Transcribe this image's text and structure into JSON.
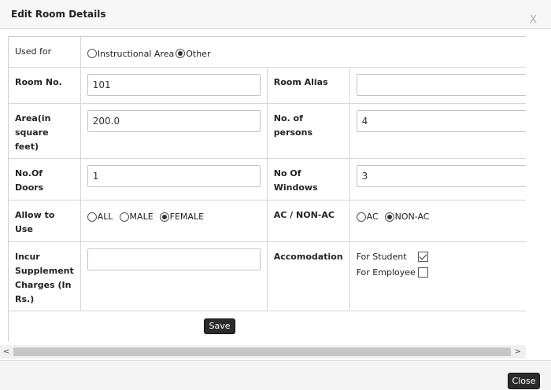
{
  "dialog": {
    "title": "Edit Room Details",
    "close_glyph": "X"
  },
  "used_for": {
    "label": "Used for",
    "options": [
      "Instructional Area",
      "Other"
    ],
    "selected": "Other"
  },
  "room_no": {
    "label": "Room No.",
    "value": "101"
  },
  "room_alias": {
    "label": "Room Alias",
    "value": ""
  },
  "area": {
    "label": "Area(in square feet)",
    "value": "200.0"
  },
  "persons": {
    "label": "No. of persons",
    "value": "4"
  },
  "doors": {
    "label": "No.Of Doors",
    "value": "1"
  },
  "windows": {
    "label": "No Of Windows",
    "value": "3"
  },
  "allow_to_use": {
    "label": "Allow to Use",
    "options": [
      "ALL",
      "MALE",
      "FEMALE"
    ],
    "selected": "FEMALE"
  },
  "ac": {
    "label": "AC / NON-AC",
    "options": [
      "AC",
      "NON-AC"
    ],
    "selected": "NON-AC"
  },
  "supplement": {
    "label": "Incur Supplement Charges (In Rs.)",
    "value": ""
  },
  "accomodation": {
    "label": "Accomodation",
    "items": [
      {
        "label": "For Student",
        "checked": true
      },
      {
        "label": "For Employee",
        "checked": false
      }
    ]
  },
  "buttons": {
    "save": "Save",
    "close": "Close"
  },
  "scrollbar": {
    "left_arrow": "<",
    "right_arrow": ">"
  }
}
